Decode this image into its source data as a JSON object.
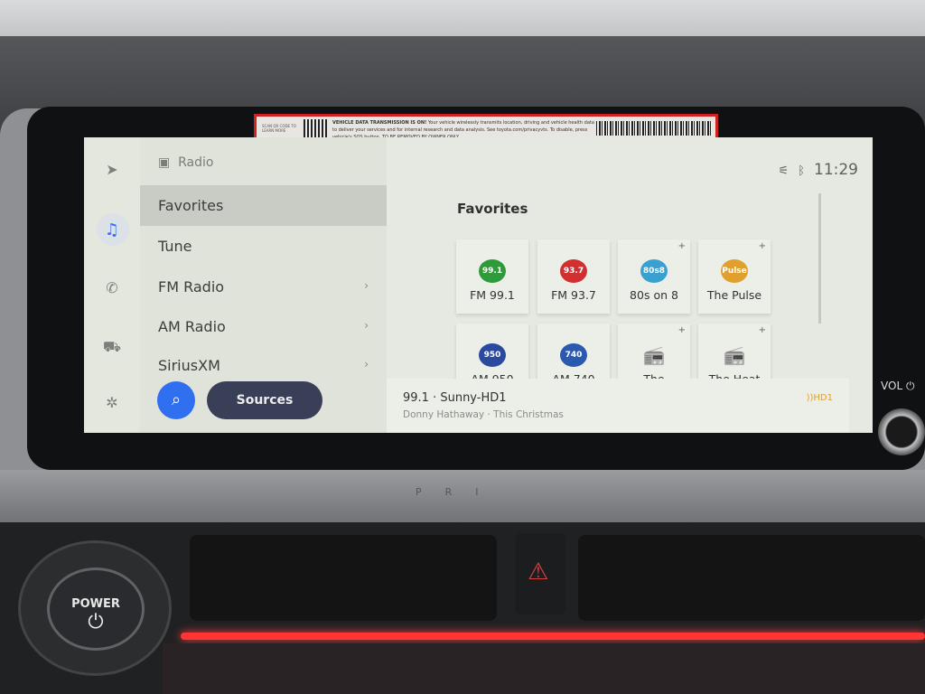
{
  "sticker": {
    "scan_text": "SCAN QR CODE TO LEARN MORE",
    "heading": "VEHICLE DATA TRANSMISSION IS ON!",
    "body": "Your vehicle wirelessly transmits location, driving and vehicle health data to deliver your services and for internal research and data analysis. See toyota.com/privacyvts. To disable, press vehicle's SOS button.",
    "removal": "TO BE REMOVED BY OWNER ONLY"
  },
  "rail": {
    "icons": [
      "navigation-icon",
      "music-icon",
      "phone-icon",
      "car-icon",
      "settings-icon"
    ],
    "active_color": "#2f6ff0"
  },
  "menu": {
    "header": "Radio",
    "items": [
      {
        "label": "Favorites",
        "selected": true,
        "chevron": false
      },
      {
        "label": "Tune",
        "selected": false,
        "chevron": false
      },
      {
        "label": "FM Radio",
        "selected": false,
        "chevron": true
      },
      {
        "label": "AM Radio",
        "selected": false,
        "chevron": true
      },
      {
        "label": "SiriusXM",
        "selected": false,
        "chevron": true
      }
    ],
    "search_icon": "search-icon",
    "sources_label": "Sources"
  },
  "status": {
    "time": "11:29",
    "icons": [
      "no-signal-icon",
      "bluetooth-icon"
    ]
  },
  "favorites": {
    "title": "Favorites",
    "tiles": [
      {
        "label": "FM 99.1",
        "logo": "99.1",
        "color": "#2e9a3a"
      },
      {
        "label": "FM 93.7",
        "logo": "93.7",
        "color": "#d03030"
      },
      {
        "label": "80s on 8",
        "logo": "80s8",
        "color": "#3aa0d0"
      },
      {
        "label": "The Pulse",
        "logo": "Pulse",
        "color": "#e0a030"
      },
      {
        "label": "AM 950",
        "logo": "950",
        "color": "#2a4aa0"
      },
      {
        "label": "AM 740",
        "logo": "740",
        "color": "#2a5ab0"
      },
      {
        "label": "The Highway",
        "logo": "radio",
        "color": "#666666"
      },
      {
        "label": "The Heat",
        "logo": "radio",
        "color": "#666666"
      }
    ]
  },
  "now_playing": {
    "title": "99.1 · Sunny-HD1",
    "subtitle": "Donny Hathaway · This Christmas",
    "hd_badge": "HD1"
  },
  "hardware": {
    "vol_label": "VOL ⏻",
    "power_label": "POWER",
    "brand_text": "PRI"
  }
}
